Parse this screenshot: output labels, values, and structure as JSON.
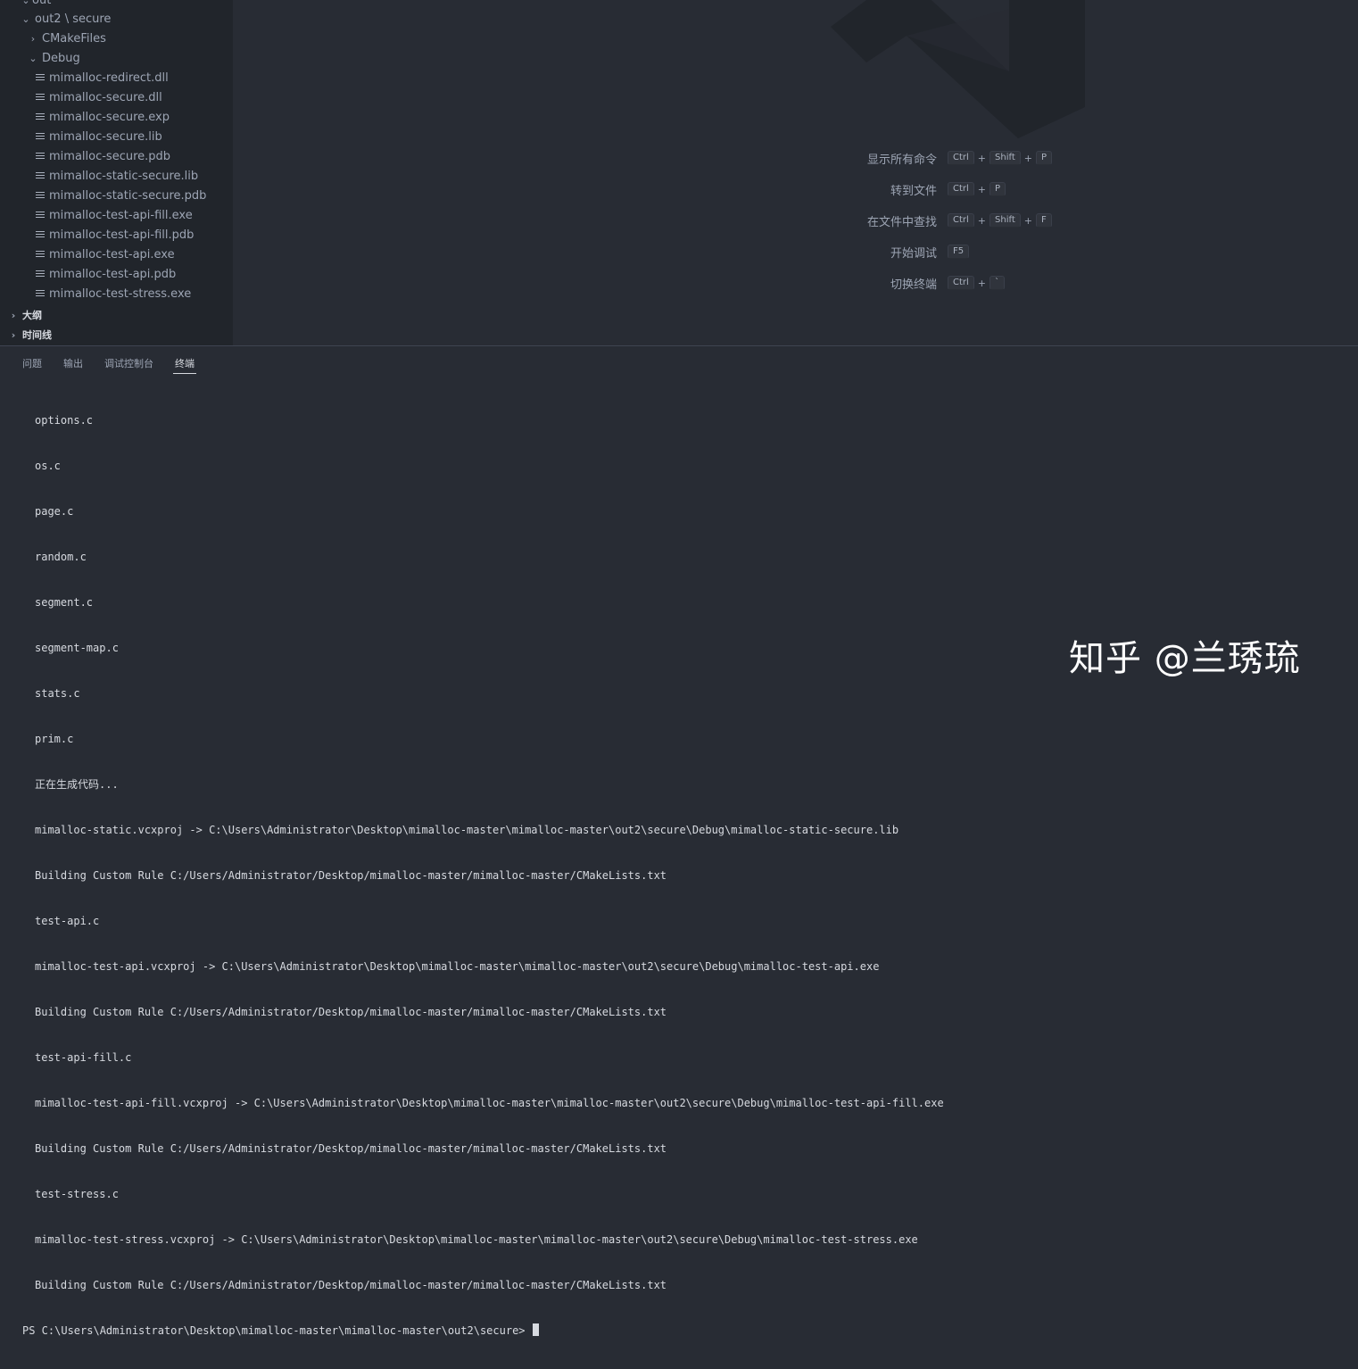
{
  "explorer": {
    "items": [
      {
        "label": "out",
        "type": "folder",
        "expanded": true
      },
      {
        "label": "out2 \\ secure",
        "type": "folder",
        "expanded": true
      },
      {
        "label": "CMakeFiles",
        "type": "folder",
        "expanded": false
      },
      {
        "label": "Debug",
        "type": "folder",
        "expanded": true
      },
      {
        "label": "mimalloc-redirect.dll",
        "type": "file"
      },
      {
        "label": "mimalloc-secure.dll",
        "type": "file"
      },
      {
        "label": "mimalloc-secure.exp",
        "type": "file"
      },
      {
        "label": "mimalloc-secure.lib",
        "type": "file"
      },
      {
        "label": "mimalloc-secure.pdb",
        "type": "file"
      },
      {
        "label": "mimalloc-static-secure.lib",
        "type": "file"
      },
      {
        "label": "mimalloc-static-secure.pdb",
        "type": "file"
      },
      {
        "label": "mimalloc-test-api-fill.exe",
        "type": "file"
      },
      {
        "label": "mimalloc-test-api-fill.pdb",
        "type": "file"
      },
      {
        "label": "mimalloc-test-api.exe",
        "type": "file"
      },
      {
        "label": "mimalloc-test-api.pdb",
        "type": "file"
      },
      {
        "label": "mimalloc-test-stress.exe",
        "type": "file"
      }
    ],
    "sections": [
      "大纲",
      "时间线"
    ]
  },
  "welcome_commands": [
    {
      "label": "显示所有命令",
      "keys": [
        "Ctrl",
        "Shift",
        "P"
      ]
    },
    {
      "label": "转到文件",
      "keys": [
        "Ctrl",
        "P"
      ]
    },
    {
      "label": "在文件中查找",
      "keys": [
        "Ctrl",
        "Shift",
        "F"
      ]
    },
    {
      "label": "开始调试",
      "keys": [
        "F5"
      ]
    },
    {
      "label": "切换终端",
      "keys": [
        "Ctrl",
        "`"
      ]
    }
  ],
  "panel": {
    "tabs": [
      "问题",
      "输出",
      "调试控制台",
      "终端"
    ],
    "active_tab": "终端"
  },
  "terminal": {
    "lines": [
      "options.c",
      "os.c",
      "page.c",
      "random.c",
      "segment.c",
      "segment-map.c",
      "stats.c",
      "prim.c",
      "正在生成代码...",
      "mimalloc-static.vcxproj -> C:\\Users\\Administrator\\Desktop\\mimalloc-master\\mimalloc-master\\out2\\secure\\Debug\\mimalloc-static-secure.lib",
      "Building Custom Rule C:/Users/Administrator/Desktop/mimalloc-master/mimalloc-master/CMakeLists.txt",
      "test-api.c",
      "mimalloc-test-api.vcxproj -> C:\\Users\\Administrator\\Desktop\\mimalloc-master\\mimalloc-master\\out2\\secure\\Debug\\mimalloc-test-api.exe",
      "Building Custom Rule C:/Users/Administrator/Desktop/mimalloc-master/mimalloc-master/CMakeLists.txt",
      "test-api-fill.c",
      "mimalloc-test-api-fill.vcxproj -> C:\\Users\\Administrator\\Desktop\\mimalloc-master\\mimalloc-master\\out2\\secure\\Debug\\mimalloc-test-api-fill.exe",
      "Building Custom Rule C:/Users/Administrator/Desktop/mimalloc-master/mimalloc-master/CMakeLists.txt",
      "test-stress.c",
      "mimalloc-test-stress.vcxproj -> C:\\Users\\Administrator\\Desktop\\mimalloc-master\\mimalloc-master\\out2\\secure\\Debug\\mimalloc-test-stress.exe",
      "Building Custom Rule C:/Users/Administrator/Desktop/mimalloc-master/mimalloc-master/CMakeLists.txt"
    ],
    "prompt": "PS C:\\Users\\Administrator\\Desktop\\mimalloc-master\\mimalloc-master\\out2\\secure>"
  },
  "watermark": "知乎 @兰琇琉"
}
